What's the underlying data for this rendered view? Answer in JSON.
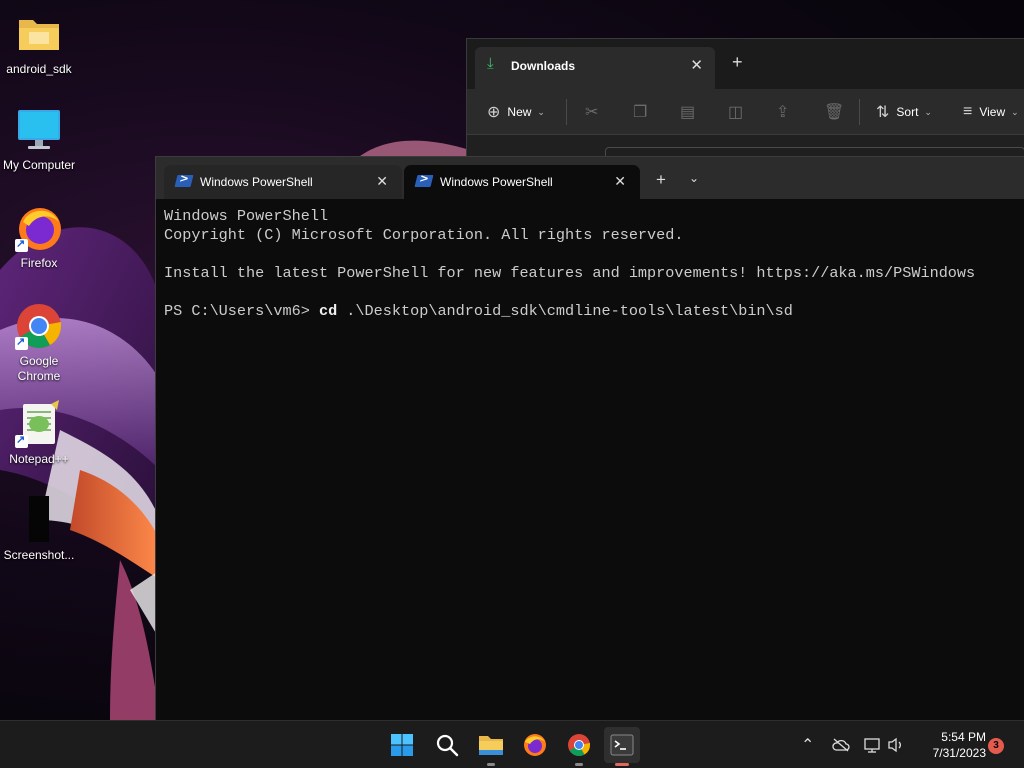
{
  "desktop": {
    "icons": [
      {
        "label": "android_sdk"
      },
      {
        "label": "My Computer"
      },
      {
        "label": "Firefox"
      },
      {
        "label": "Google Chrome"
      },
      {
        "label": "Notepad++"
      },
      {
        "label": "Screenshot..."
      }
    ]
  },
  "explorer": {
    "tab_title": "Downloads",
    "toolbar": {
      "new_label": "New",
      "sort_label": "Sort",
      "view_label": "View"
    }
  },
  "terminal": {
    "tabs": [
      {
        "title": "Windows PowerShell"
      },
      {
        "title": "Windows PowerShell"
      }
    ],
    "lines": {
      "l1": "Windows PowerShell",
      "l2": "Copyright (C) Microsoft Corporation. All rights reserved.",
      "l3": "Install the latest PowerShell for new features and improvements! https://aka.ms/PSWindows",
      "prompt": "PS C:\\Users\\vm6> ",
      "command": "cd",
      "argument": " .\\Desktop\\android_sdk\\cmdline-tools\\latest\\bin\\sd"
    }
  },
  "taskbar": {
    "time": "5:54 PM",
    "date": "7/31/2023",
    "notification_count": "3"
  },
  "colors": {
    "terminal_bg": "#0c0c0c",
    "taskbar_bg": "#1c1c1c",
    "accent_blue": "#2a5fb8",
    "notification": "#e45b4d"
  }
}
